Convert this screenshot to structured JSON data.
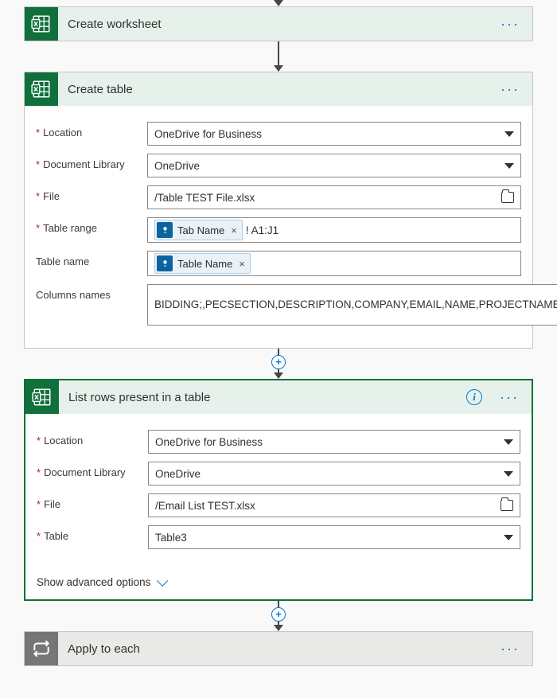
{
  "steps": {
    "create_worksheet": {
      "title": "Create worksheet"
    },
    "create_table": {
      "title": "Create table",
      "fields": {
        "location_label": "Location",
        "location_value": "OneDrive for Business",
        "doclib_label": "Document Library",
        "doclib_value": "OneDrive",
        "file_label": "File",
        "file_value": "/Table TEST File.xlsx",
        "range_label": "Table range",
        "range_token": "Tab Name",
        "range_suffix": "! A1:J1",
        "tablename_label": "Table name",
        "tablename_token": "Table Name",
        "columns_label": "Columns names",
        "columns_value": "BIDDING;,PECSECTION,DESCRIPTION,COMPANY,EMAIL,NAME,PROJECTNAME,DUEDATE,LOCATION,DATESENT"
      }
    },
    "list_rows": {
      "title": "List rows present in a table",
      "fields": {
        "location_label": "Location",
        "location_value": "OneDrive for Business",
        "doclib_label": "Document Library",
        "doclib_value": "OneDrive",
        "file_label": "File",
        "file_value": "/Email List TEST.xlsx",
        "table_label": "Table",
        "table_value": "Table3"
      },
      "advanced_toggle": "Show advanced options"
    },
    "apply_each": {
      "title": "Apply to each"
    }
  }
}
